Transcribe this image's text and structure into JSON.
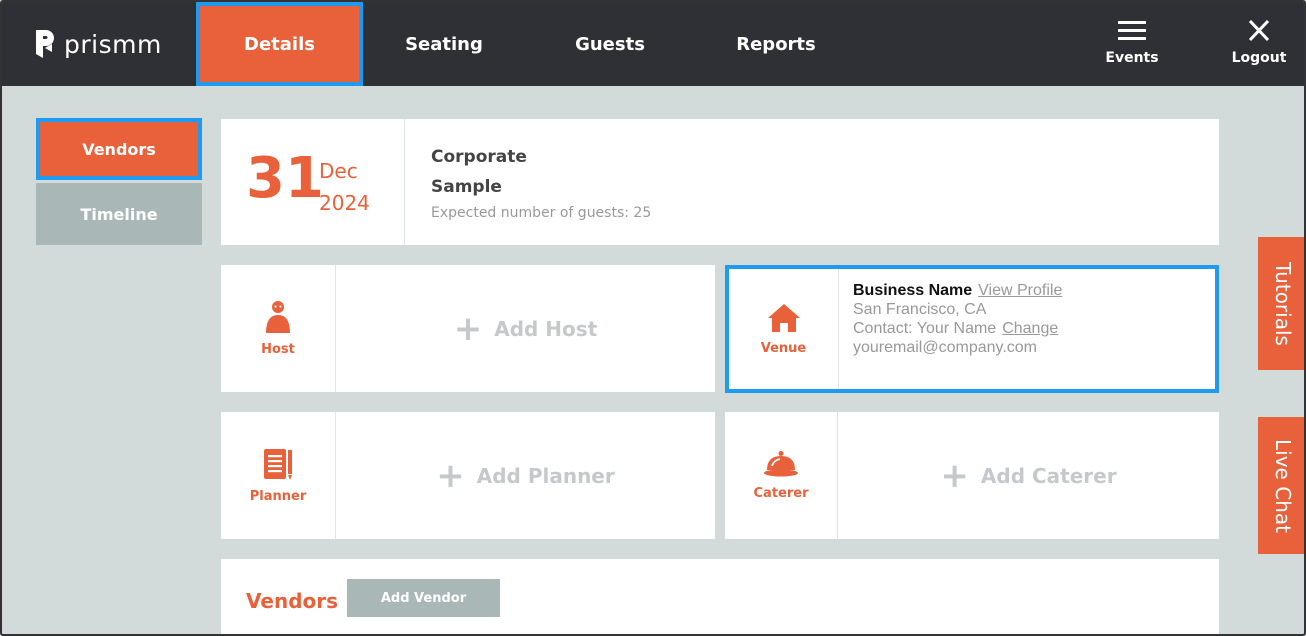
{
  "app": {
    "logo_text": "prismm"
  },
  "nav": {
    "tabs": [
      {
        "label": "Details",
        "active": true
      },
      {
        "label": "Seating",
        "active": false
      },
      {
        "label": "Guests",
        "active": false
      },
      {
        "label": "Reports",
        "active": false
      }
    ],
    "actions": [
      {
        "label": "Events",
        "icon": "menu-icon"
      },
      {
        "label": "Logout",
        "icon": "close-icon"
      }
    ]
  },
  "sidebar": {
    "items": [
      {
        "label": "Vendors",
        "active": true
      },
      {
        "label": "Timeline",
        "active": false
      }
    ]
  },
  "event": {
    "day": "31",
    "month": "Dec",
    "year": "2024",
    "name_line1": "Corporate",
    "name_line2": "Sample",
    "guests_text": "Expected number of guests: 25"
  },
  "roles": {
    "host": {
      "label": "Host",
      "add_label": "Add Host",
      "icon": "person-icon"
    },
    "venue": {
      "label": "Venue",
      "icon": "house-icon",
      "business_name": "Business Name",
      "view_profile": "View Profile",
      "location": "San Francisco, CA",
      "contact": "Contact: Your Name",
      "change": "Change",
      "email": "youremail@company.com"
    },
    "planner": {
      "label": "Planner",
      "add_label": "Add Planner",
      "icon": "notepad-icon"
    },
    "caterer": {
      "label": "Caterer",
      "add_label": "Add Caterer",
      "icon": "cloche-icon"
    }
  },
  "vendors": {
    "title": "Vendors",
    "add_button": "Add Vendor"
  },
  "right_tabs": {
    "tutorials": "Tutorials",
    "live_chat": "Live Chat"
  },
  "colors": {
    "accent": "#e8613a",
    "dark_bar": "#2f3035",
    "muted": "#a9b8b7",
    "highlight": "#1e9bf0",
    "background": "#d3dada"
  }
}
